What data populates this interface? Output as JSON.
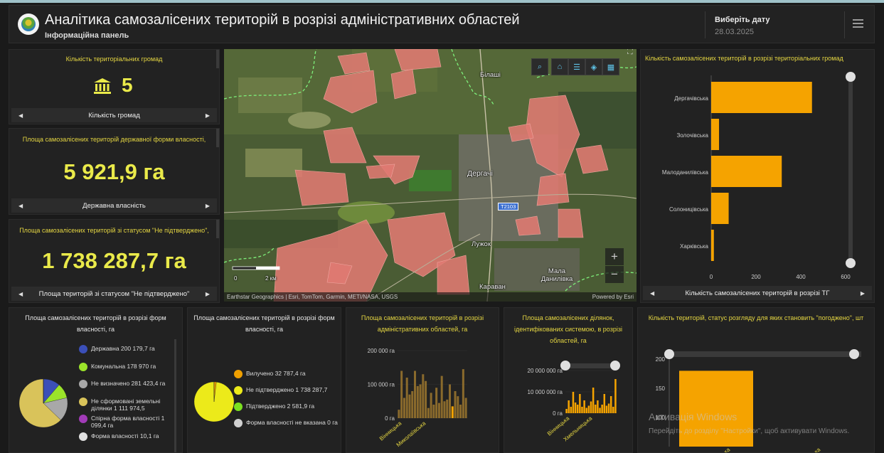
{
  "header": {
    "title": "Аналітика самозалісених територій в розрізі адміністративних областей",
    "subtitle": "Інформаційна панель",
    "date_label": "Виберіть дату",
    "date_value": "28.03.2025"
  },
  "kpi1": {
    "title": "Кількість територіальних громад",
    "value": "5",
    "nav_label": "Кількість громад"
  },
  "kpi2": {
    "title": "Площа самозалісених територій державної форми власності,",
    "value": "5 921,9 га",
    "nav_label": "Державна власність"
  },
  "kpi3": {
    "title": "Площа самозалісених територій зі статусом \"Не підтверджено\",",
    "value": "1 738 287,7 га",
    "nav_label": "Площа територій зі статусом \"Не підтверджено\""
  },
  "map": {
    "labels": [
      "Білаші",
      "Дергачі",
      "Лужок",
      "Мала Данилівка",
      "Караван"
    ],
    "road_label": "Т2103",
    "scale": [
      "0",
      "2 км"
    ],
    "attribution": "Earthstar Geographics | Esri, TomTom, Garmin, METI/NASA, USGS",
    "powered": "Powered by Esri",
    "icons": [
      "search-icon",
      "home-icon",
      "list-icon",
      "layers-icon",
      "grid-icon"
    ]
  },
  "panel_hromady": {
    "title": "Кількість самозалісених територій в розрізі територіальних громад",
    "nav_label": "Кількість самозалісених територій в розрізі ТГ"
  },
  "panel_ownership": {
    "title": "Площа самозалісених територій в розрізі форм власності, га",
    "legend": [
      {
        "label": "Державна",
        "value": "200 179,7 га",
        "color": "#3b4fb8"
      },
      {
        "label": "Комунальна",
        "value": "178 970 га",
        "color": "#9be32a"
      },
      {
        "label": "Не визначено",
        "value": "281 423,4 га",
        "color": "#a8a8a8"
      },
      {
        "label": "Не сформовані земельні ділянки",
        "value": "1 111 974,5",
        "color": "#d9c35a"
      },
      {
        "label": "Спірна форма власності",
        "value": "1 099,4 га",
        "color": "#a23bb8"
      },
      {
        "label": "Форма власності",
        "value": "10,1 га",
        "color": "#e0e0e0"
      }
    ]
  },
  "panel_status": {
    "title": "Площа самозалісених територій в розрізі форм власності, га",
    "legend": [
      {
        "label": "Вилучено",
        "value": "32 787,4 га",
        "color": "#f0a000"
      },
      {
        "label": "Не підтверджено",
        "value": "1 738 287,7",
        "color": "#ecea1a"
      },
      {
        "label": "Підтверджено",
        "value": "2 581,9 га",
        "color": "#7be020"
      },
      {
        "label": "Форма власності не вказана",
        "value": "0 га",
        "color": "#d0d0d0"
      }
    ]
  },
  "panel_oblasti": {
    "title": "Площа самозалісених територій в розрізі адміністративних областей, га"
  },
  "panel_parcels": {
    "title": "Площа самозалісених ділянок, ідентифікованих системою, в розрізі областей, га"
  },
  "panel_agreed": {
    "title": "Кількість територій, статус розгляду для яких становить \"погоджено\", шт"
  },
  "watermark": {
    "title": "Активація Windows",
    "text": "Перейдіть до розділу \"Настройки\", щоб активувати Windows."
  },
  "chart_data": [
    {
      "type": "bar",
      "orientation": "horizontal",
      "title": "Кількість самозалісених територій в розрізі територіальних громад",
      "categories": [
        "Дергачівська",
        "Золочівська",
        "Малоданилівська",
        "Солоницівська",
        "Харківська"
      ],
      "values": [
        450,
        35,
        315,
        78,
        12
      ],
      "xlim": [
        0,
        600
      ],
      "xticks": [
        0,
        200,
        400,
        600
      ],
      "color": "#f5a300"
    },
    {
      "type": "pie",
      "title": "Площа самозалісених територій в розрізі форм власності, га",
      "categories": [
        "Державна",
        "Комунальна",
        "Не визначено",
        "Не сформовані земельні ділянки",
        "Спірна форма власності",
        "Форма власності"
      ],
      "values": [
        200179.7,
        178970,
        281423.4,
        1111974.5,
        1099.4,
        10.1
      ],
      "colors": [
        "#3b4fb8",
        "#9be32a",
        "#a8a8a8",
        "#d9c35a",
        "#a23bb8",
        "#e0e0e0"
      ]
    },
    {
      "type": "pie",
      "title": "Площа самозалісених територій в розрізі форм власності, га",
      "categories": [
        "Вилучено",
        "Не підтверджено",
        "Підтверджено",
        "Форма власності не вказана"
      ],
      "values": [
        32787.4,
        1738287.7,
        2581.9,
        0
      ],
      "colors": [
        "#f0a000",
        "#ecea1a",
        "#7be020",
        "#d0d0d0"
      ]
    },
    {
      "type": "bar",
      "title": "Площа самозалісених територій в розрізі адміністративних областей, га",
      "category_labels": [
        "Вінницька",
        "Миколаївська"
      ],
      "values": [
        25000,
        140000,
        60000,
        120000,
        70000,
        80000,
        140000,
        95000,
        100000,
        130000,
        110000,
        30000,
        75000,
        40000,
        90000,
        45000,
        125000,
        50000,
        55000,
        100000,
        35000,
        80000,
        65000,
        40000,
        145000,
        60000
      ],
      "highlight_index": 20,
      "ylim": [
        0,
        200000
      ],
      "yticks": [
        "0 га",
        "100 000 га",
        "200 000 га"
      ],
      "color": "#8a6a2c",
      "highlight_color": "#f5a300"
    },
    {
      "type": "bar",
      "title": "Площа самозалісених ділянок, ідентифікованих системою, в розрізі областей, га",
      "category_labels": [
        "Вінницька",
        "Хмельницька"
      ],
      "values": [
        2000000,
        6000000,
        3000000,
        10000000,
        5000000,
        4000000,
        9000000,
        3000000,
        6000000,
        2500000,
        3500000,
        5500000,
        12000000,
        4000000,
        6000000,
        2500000,
        4000000,
        9000000,
        3500000,
        4500000,
        8000000,
        3000000,
        16000000
      ],
      "ylim": [
        0,
        20000000
      ],
      "yticks": [
        "0 га",
        "10 000 000 га",
        "20 000 000 га"
      ],
      "color": "#f5a300"
    },
    {
      "type": "bar",
      "title": "Кількість територій, статус розгляду для яких становить \"погоджено\", шт",
      "categories": [
        "Полтавська",
        "Харківська"
      ],
      "values": [
        180,
        20
      ],
      "ylim": [
        0,
        200
      ],
      "yticks": [
        100,
        150,
        200
      ],
      "color": "#f5a300"
    }
  ]
}
